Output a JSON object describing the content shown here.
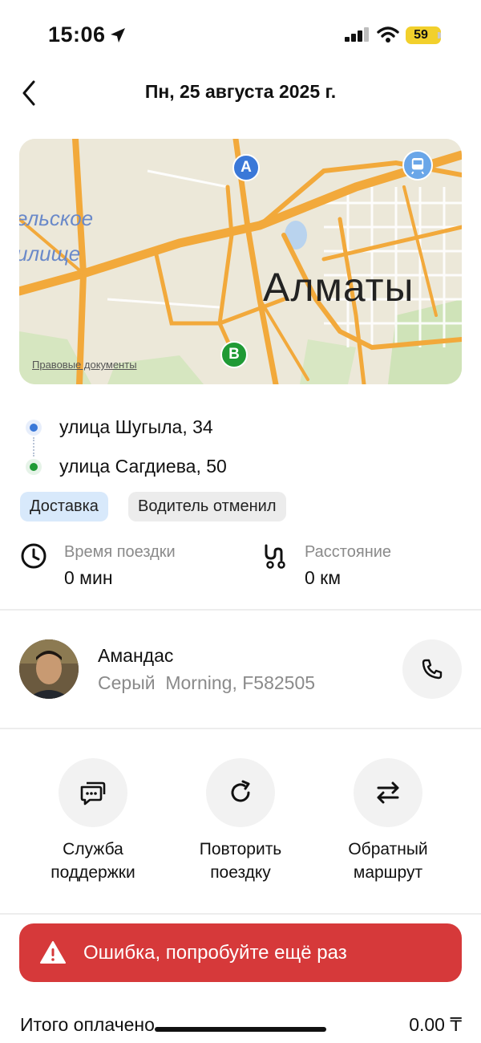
{
  "status_bar": {
    "time": "15:06",
    "battery": "59",
    "icons": [
      "location-arrow-icon",
      "cellular-signal-icon",
      "wifi-icon",
      "battery-icon"
    ]
  },
  "header": {
    "title": "Пн, 25 августа 2025 г.",
    "back_icon": "chevron-left-icon"
  },
  "map": {
    "city_label": "Алматы",
    "street_label_line1": "ельское",
    "street_label_line2": "илище",
    "legal_link": "Правовые документы",
    "pin_a": "A",
    "pin_b": "B",
    "metro_icon": "metro-icon"
  },
  "route": {
    "from": "улица Шугыла, 34",
    "to": "улица Сагдиева, 50"
  },
  "tags": {
    "type": "Доставка",
    "status": "Водитель отменил"
  },
  "stats": {
    "time_label": "Время поездки",
    "time_value": "0 мин",
    "distance_label": "Расстояние",
    "distance_value": "0 км"
  },
  "driver": {
    "name": "Амандас",
    "car": "Серый  Morning, F582505"
  },
  "actions": {
    "support_line1": "Служба",
    "support_line2": "поддержки",
    "repeat_line1": "Повторить",
    "repeat_line2": "поездку",
    "reverse_line1": "Обратный",
    "reverse_line2": "маршрут"
  },
  "toast": {
    "message": "Ошибка, попробуйте ещё раз"
  },
  "total": {
    "label": "Итого оплачено",
    "value": "0.00 ₸"
  },
  "colors": {
    "accent_blue": "#3a78d8",
    "accent_green": "#1f9a35",
    "error_red": "#d6393a",
    "battery_yellow": "#f2d02c",
    "road_orange": "#f2a93b"
  }
}
